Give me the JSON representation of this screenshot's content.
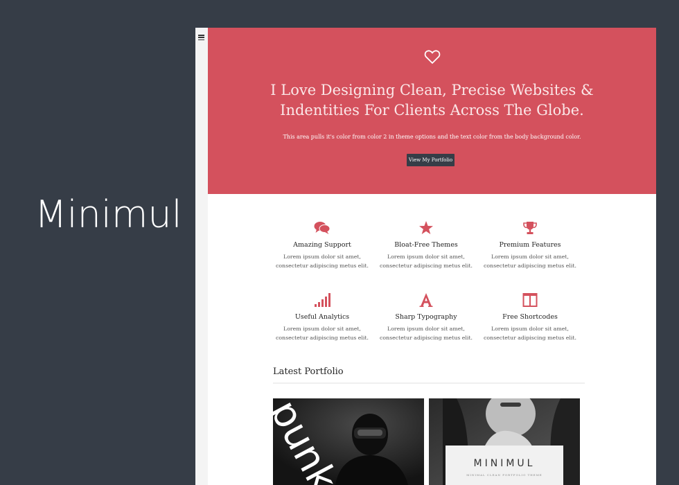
{
  "brand": {
    "name": "Minimul"
  },
  "hero": {
    "title_line1": "I Love Designing Clean, Precise Websites &",
    "title_line2": "Indentities For Clients Across The Globe.",
    "subtitle": "This area pulls it's color from color 2 in theme options and the text color from the body background color.",
    "button_label": "View My Portfolio"
  },
  "features": [
    {
      "icon": "chat-bubbles-icon",
      "title": "Amazing Support",
      "desc1": "Lorem ipsum dolor sit amet,",
      "desc2": "consectetur adipiscing metus elit."
    },
    {
      "icon": "star-icon",
      "title": "Bloat-Free Themes",
      "desc1": "Lorem ipsum dolor sit amet,",
      "desc2": "consectetur adipiscing metus elit."
    },
    {
      "icon": "trophy-icon",
      "title": "Premium Features",
      "desc1": "Lorem ipsum dolor sit amet,",
      "desc2": "consectetur adipiscing metus elit."
    },
    {
      "icon": "signal-bars-icon",
      "title": "Useful Analytics",
      "desc1": "Lorem ipsum dolor sit amet,",
      "desc2": "consectetur adipiscing metus elit."
    },
    {
      "icon": "letter-a-icon",
      "title": "Sharp Typography",
      "desc1": "Lorem ipsum dolor sit amet,",
      "desc2": "consectetur adipiscing metus elit."
    },
    {
      "icon": "columns-icon",
      "title": "Free Shortcodes",
      "desc1": "Lorem ipsum dolor sit amet,",
      "desc2": "consectetur adipiscing metus elit."
    }
  ],
  "portfolio": {
    "title": "Latest Portfolio",
    "items": [
      {
        "overlay_text": "punk"
      },
      {
        "card_title": "MINIMUL",
        "card_sub": "MINIMAL CLEAN PORTFOLIO THEME"
      }
    ]
  },
  "colors": {
    "accent": "#d4515d",
    "dark": "#363d47",
    "background": "#ffffff"
  }
}
